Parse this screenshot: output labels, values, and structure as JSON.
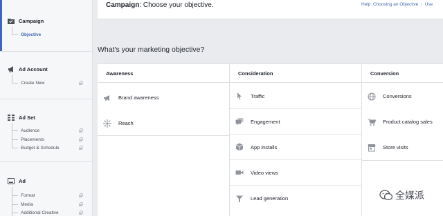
{
  "sidebar": {
    "sections": [
      {
        "title": "Campaign",
        "icon": "folder-check-icon",
        "items": [
          {
            "label": "Objective",
            "locked": false,
            "active": true
          }
        ]
      },
      {
        "title": "Ad Account",
        "icon": "megaphone-icon",
        "items": [
          {
            "label": "Create New",
            "locked": true
          }
        ]
      },
      {
        "title": "Ad Set",
        "icon": "grid-icon",
        "items": [
          {
            "label": "Audience",
            "locked": true
          },
          {
            "label": "Placements",
            "locked": true
          },
          {
            "label": "Budget & Schedule",
            "locked": true
          }
        ]
      },
      {
        "title": "Ad",
        "icon": "ad-frame-icon",
        "items": [
          {
            "label": "Format",
            "locked": true
          },
          {
            "label": "Media",
            "locked": true
          },
          {
            "label": "Additional Creative",
            "locked": true
          }
        ]
      }
    ]
  },
  "header": {
    "title_bold": "Campaign",
    "title_rest": ": Choose your objective.",
    "help_link": "Help: Choosing an Objective",
    "help_separator": "|",
    "help_link_2": "Use"
  },
  "main": {
    "question": "What's your marketing objective?",
    "columns": [
      {
        "heading": "Awareness",
        "options": [
          {
            "label": "Brand awareness",
            "icon": "megaphone-icon"
          },
          {
            "label": "Reach",
            "icon": "starburst-icon"
          }
        ]
      },
      {
        "heading": "Consideration",
        "options": [
          {
            "label": "Traffic",
            "icon": "cursor-icon"
          },
          {
            "label": "Engagement",
            "icon": "chat-bubbles-icon"
          },
          {
            "label": "App installs",
            "icon": "box-icon"
          },
          {
            "label": "Video views",
            "icon": "video-camera-icon"
          },
          {
            "label": "Lead generation",
            "icon": "funnel-icon"
          }
        ]
      },
      {
        "heading": "Conversion",
        "options": [
          {
            "label": "Conversions",
            "icon": "globe-icon"
          },
          {
            "label": "Product catalog sales",
            "icon": "cart-icon"
          },
          {
            "label": "Store visits",
            "icon": "store-icon"
          }
        ]
      }
    ]
  },
  "watermark": {
    "text": "全媒派"
  },
  "colors": {
    "accent": "#4267b2",
    "icon_gray": "#90949c",
    "border": "#dddfe2",
    "background": "#e9ebee"
  }
}
